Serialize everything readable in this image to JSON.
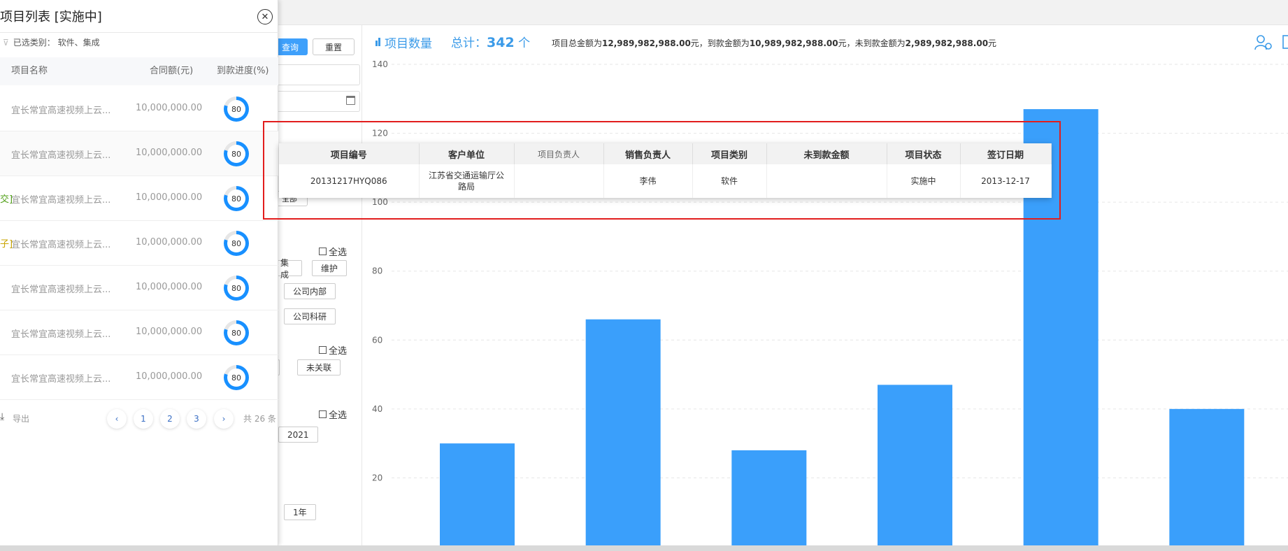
{
  "drawer": {
    "title": "项目列表 [实施中]",
    "close_icon": "close-circle-icon",
    "filter_note": "已选类别：  软件、集成",
    "columns": [
      "项目名称",
      "合同额(元)",
      "到款进度(%)"
    ],
    "rows": [
      {
        "prefix": "",
        "name": "宜长常宜高速视频上云...",
        "amount": "10,000,000.00",
        "progress": "80"
      },
      {
        "prefix": "",
        "name": "宜长常宜高速视频上云...",
        "amount": "10,000,000.00",
        "progress": "80"
      },
      {
        "prefix": "交]",
        "prefix_color": "#52a01a",
        "name": "宜长常宜高速视频上云...",
        "amount": "10,000,000.00",
        "progress": "80"
      },
      {
        "prefix": "子]",
        "prefix_color": "#c9a400",
        "name": "宜长常宜高速视频上云...",
        "amount": "10,000,000.00",
        "progress": "80"
      },
      {
        "prefix": "",
        "name": "宜长常宜高速视频上云...",
        "amount": "10,000,000.00",
        "progress": "80"
      },
      {
        "prefix": "",
        "name": "宜长常宜高速视频上云...",
        "amount": "10,000,000.00",
        "progress": "80"
      },
      {
        "prefix": "",
        "name": "宜长常宜高速视频上云...",
        "amount": "10,000,000.00",
        "progress": "80"
      }
    ],
    "export_label": "导出",
    "pager": {
      "prev": "‹",
      "pages": [
        "1",
        "2",
        "3"
      ],
      "next": "›",
      "total": "共 26 条"
    }
  },
  "filters": {
    "query_label": "查询",
    "reset_label": "重置",
    "select_all_1": "全选",
    "select_all_2": "全选",
    "select_all_3": "全选",
    "tag_integration": "集成",
    "tag_maintain": "维护",
    "tag_internal": "公司内部",
    "tag_research": "公司科研",
    "tag_unlinked": "未关联",
    "tag_year": "2021",
    "tag_1year": "1年",
    "partial_tag": "全部"
  },
  "chart_header": {
    "title": "项目数量",
    "total_label": "总计：",
    "total_value": "342",
    "total_unit": "个",
    "summary_a": "项目总金额为",
    "summary_a_val": "12,989,982,988.00",
    "summary_b": "元，到款金额为",
    "summary_b_val": "10,989,982,988.00",
    "summary_c": "元，未到款金额为",
    "summary_c_val": "2,989,982,988.00",
    "summary_d": "元",
    "icons": [
      "user-settings-icon",
      "export-icon"
    ]
  },
  "chart_data": {
    "type": "bar",
    "ylim": [
      0,
      140
    ],
    "y_ticks": [
      "20",
      "40",
      "60",
      "80",
      "100",
      "120",
      "140"
    ],
    "values": [
      30,
      66,
      28,
      47,
      127,
      40
    ],
    "color": "#3a9ffb"
  },
  "popup": {
    "headers": [
      "项目编号",
      "客户单位",
      "项目负责人",
      "销售负责人",
      "项目类别",
      "未到款金额",
      "项目状态",
      "签订日期"
    ],
    "row": [
      "20131217HYQ086",
      "江苏省交通运输厅公路局",
      "",
      "李伟",
      "软件",
      "",
      "实施中",
      "2013-12-17"
    ]
  },
  "colors": {
    "accent": "#3a9ae8",
    "highlight": "#e21d1d"
  }
}
